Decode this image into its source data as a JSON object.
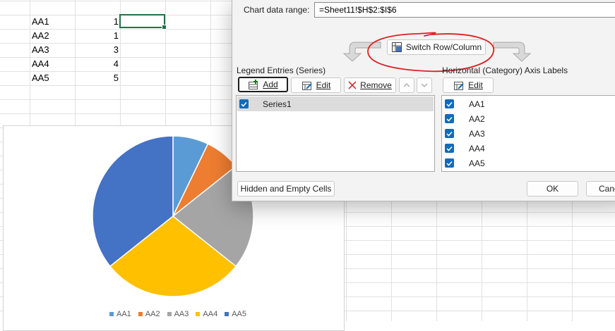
{
  "sheet": {
    "rows": [
      {
        "label": "AA1",
        "value": "1"
      },
      {
        "label": "AA2",
        "value": "1"
      },
      {
        "label": "AA3",
        "value": "3"
      },
      {
        "label": "AA4",
        "value": "4"
      },
      {
        "label": "AA5",
        "value": "5"
      }
    ]
  },
  "chart_data": {
    "type": "pie",
    "categories": [
      "AA1",
      "AA2",
      "AA3",
      "AA4",
      "AA5"
    ],
    "values": [
      1,
      1,
      3,
      4,
      5
    ],
    "colors": [
      "#5b9bd5",
      "#ed7d31",
      "#a5a5a5",
      "#ffc000",
      "#4472c4"
    ],
    "title": "",
    "legend_position": "bottom"
  },
  "dialog": {
    "range_label": "Chart data range:",
    "range_value": "=Sheet11!$H$2:$I$6",
    "switch_label": "Switch Row/Column",
    "legend_header": "Legend Entries (Series)",
    "axis_header": "Horizontal (Category) Axis Labels",
    "add_label": "Add",
    "edit_label": "Edit",
    "remove_label": "Remove",
    "axis_edit_label": "Edit",
    "series": [
      "Series1"
    ],
    "axis_labels": [
      "AA1",
      "AA2",
      "AA3",
      "AA4",
      "AA5"
    ],
    "hidden_cells_label": "Hidden and Empty Cells",
    "ok_label": "OK",
    "cancel_label": "Cance"
  },
  "annotation": {
    "color": "#e02020"
  }
}
